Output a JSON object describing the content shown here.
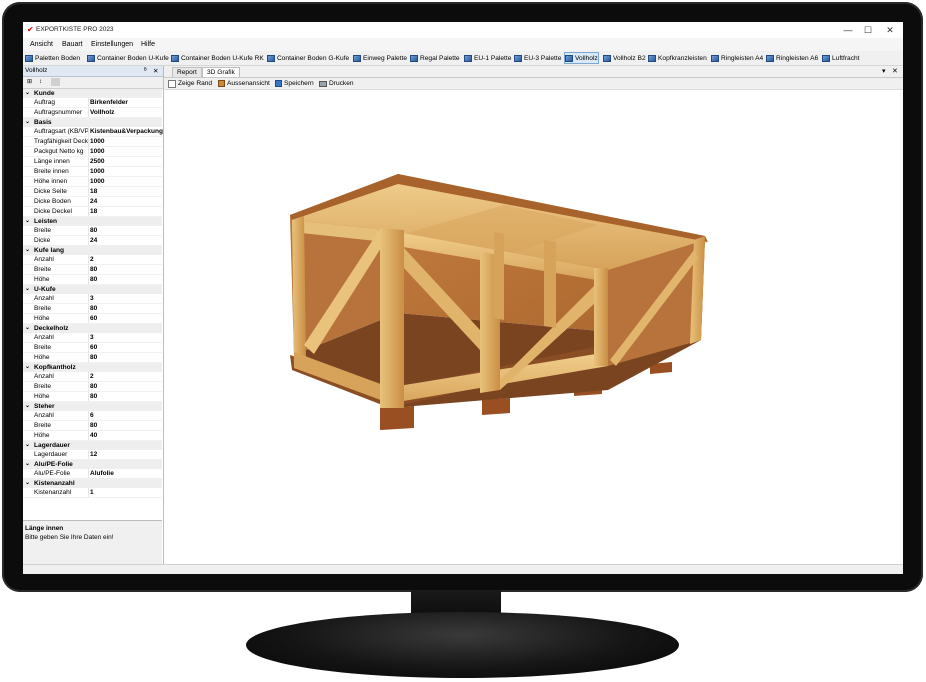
{
  "window": {
    "title": "EXPORTKISTE PRO 2023",
    "minimize": "—",
    "maximize": "☐",
    "close": "✕"
  },
  "menu": [
    "Ansicht",
    "Bauart",
    "Einstellungen",
    "Hilfe"
  ],
  "toolbar": {
    "items": [
      "Paletten Boden",
      "Container Boden U-Kufe",
      "Container Boden U-Kufe RK",
      "Container Boden G-Kufe",
      "Einweg Palette",
      "Regal Palette",
      "EU-1 Palette",
      "EU-3 Palette",
      "Vollholz",
      "Vollholz B2",
      "Kopfkranzleisten",
      "Ringleisten A4",
      "Ringleisten A6",
      "Luftfracht"
    ],
    "active": "Vollholz"
  },
  "left_panel": {
    "title": "Vollholz",
    "pin": "ᴮ",
    "close": "✕",
    "sort_categorized": "⊞",
    "sort_alpha": "↕",
    "categories": [
      {
        "name": "Kunde",
        "props": [
          {
            "n": "Auftrag",
            "v": "Birkenfelder"
          },
          {
            "n": "Auftragsnummer",
            "v": "Vollholz"
          }
        ]
      },
      {
        "name": "Basis",
        "props": [
          {
            "n": "Auftragsart (KB/VP",
            "v": "Kistenbau&Verpackung"
          },
          {
            "n": "Tragfähigkeit Deck",
            "v": "1000"
          },
          {
            "n": "Packgut Netto kg",
            "v": "1000"
          },
          {
            "n": "Länge innen",
            "v": "2500"
          },
          {
            "n": "Breite innen",
            "v": "1000"
          },
          {
            "n": "Höhe innen",
            "v": "1000"
          },
          {
            "n": "Dicke Seite",
            "v": "18"
          },
          {
            "n": "Dicke Boden",
            "v": "24"
          },
          {
            "n": "Dicke Deckel",
            "v": "18"
          }
        ]
      },
      {
        "name": "Leisten",
        "props": [
          {
            "n": "Breite",
            "v": "80"
          },
          {
            "n": "Dicke",
            "v": "24"
          }
        ]
      },
      {
        "name": "Kufe lang",
        "props": [
          {
            "n": "Anzahl",
            "v": "2"
          },
          {
            "n": "Breite",
            "v": "80"
          },
          {
            "n": "Höhe",
            "v": "80"
          }
        ]
      },
      {
        "name": "U-Kufe",
        "props": [
          {
            "n": "Anzahl",
            "v": "3"
          },
          {
            "n": "Breite",
            "v": "80"
          },
          {
            "n": "Höhe",
            "v": "60"
          }
        ]
      },
      {
        "name": "Deckelholz",
        "props": [
          {
            "n": "Anzahl",
            "v": "3"
          },
          {
            "n": "Breite",
            "v": "60"
          },
          {
            "n": "Höhe",
            "v": "80"
          }
        ]
      },
      {
        "name": "Kopfkantholz",
        "props": [
          {
            "n": "Anzahl",
            "v": "2"
          },
          {
            "n": "Breite",
            "v": "80"
          },
          {
            "n": "Höhe",
            "v": "80"
          }
        ]
      },
      {
        "name": "Steher",
        "props": [
          {
            "n": "Anzahl",
            "v": "6"
          },
          {
            "n": "Breite",
            "v": "80"
          },
          {
            "n": "Höhe",
            "v": "40"
          }
        ]
      },
      {
        "name": "Lagerdauer",
        "props": [
          {
            "n": "Lagerdauer",
            "v": "12"
          }
        ]
      },
      {
        "name": "Alu/PE-Folie",
        "props": [
          {
            "n": "Alu/PE-Folie",
            "v": "Alufolie"
          }
        ]
      },
      {
        "name": "Kistenanzahl",
        "props": [
          {
            "n": "Kistenanzahl",
            "v": "1"
          }
        ]
      }
    ],
    "description": {
      "title": "Länge innen",
      "text": "Bitte geben Sie Ihre Daten ein!"
    }
  },
  "tabs": {
    "items": [
      "Report",
      "3D Grafik"
    ],
    "active": "3D Grafik",
    "dropdown": "▾",
    "close": "✕"
  },
  "viewer_toolbar": {
    "show_edge": "Zeige Rand",
    "outside_view": "Aussenansicht",
    "save": "Speichern",
    "print": "Drucken"
  },
  "colors": {
    "accent": "#dbe8f6",
    "wood_light": "#e8c07a",
    "wood_mid": "#d9a55c",
    "wood_dark": "#b07030",
    "plywood": "#b8733c"
  }
}
